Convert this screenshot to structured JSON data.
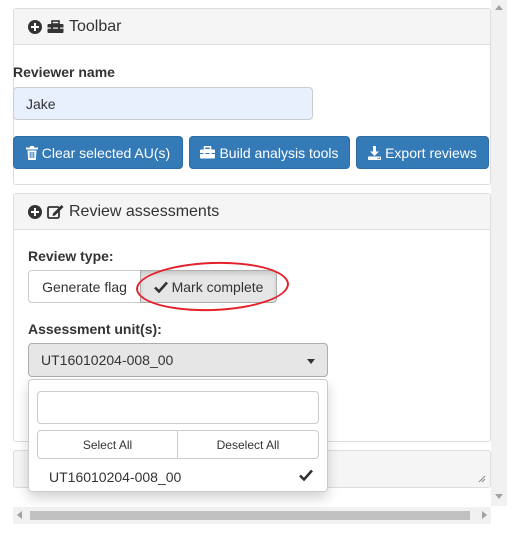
{
  "toolbar": {
    "title": "Toolbar",
    "reviewer_label": "Reviewer name",
    "reviewer_value": "Jake",
    "buttons": {
      "clear": "Clear selected AU(s)",
      "build": "Build analysis tools",
      "export": "Export reviews"
    }
  },
  "review": {
    "title": "Review assessments",
    "type_label": "Review type:",
    "type_options": [
      "Generate flag",
      "Mark complete"
    ],
    "type_selected": "Mark complete",
    "au_label": "Assessment unit(s):",
    "au_selected": "UT16010204-008_00",
    "dropdown": {
      "search_value": "",
      "select_all": "Select All",
      "deselect_all": "Deselect All",
      "items": [
        {
          "label": "UT16010204-008_00",
          "checked": true
        }
      ]
    }
  },
  "colors": {
    "primary": "#337ab7",
    "annotation": "#e4212b",
    "input_autofill": "#e8f0fe"
  },
  "icons": [
    "plus-circle-icon",
    "toolbox-icon",
    "edit-icon",
    "trash-icon",
    "download-icon",
    "check-icon",
    "chevron-down-icon"
  ]
}
